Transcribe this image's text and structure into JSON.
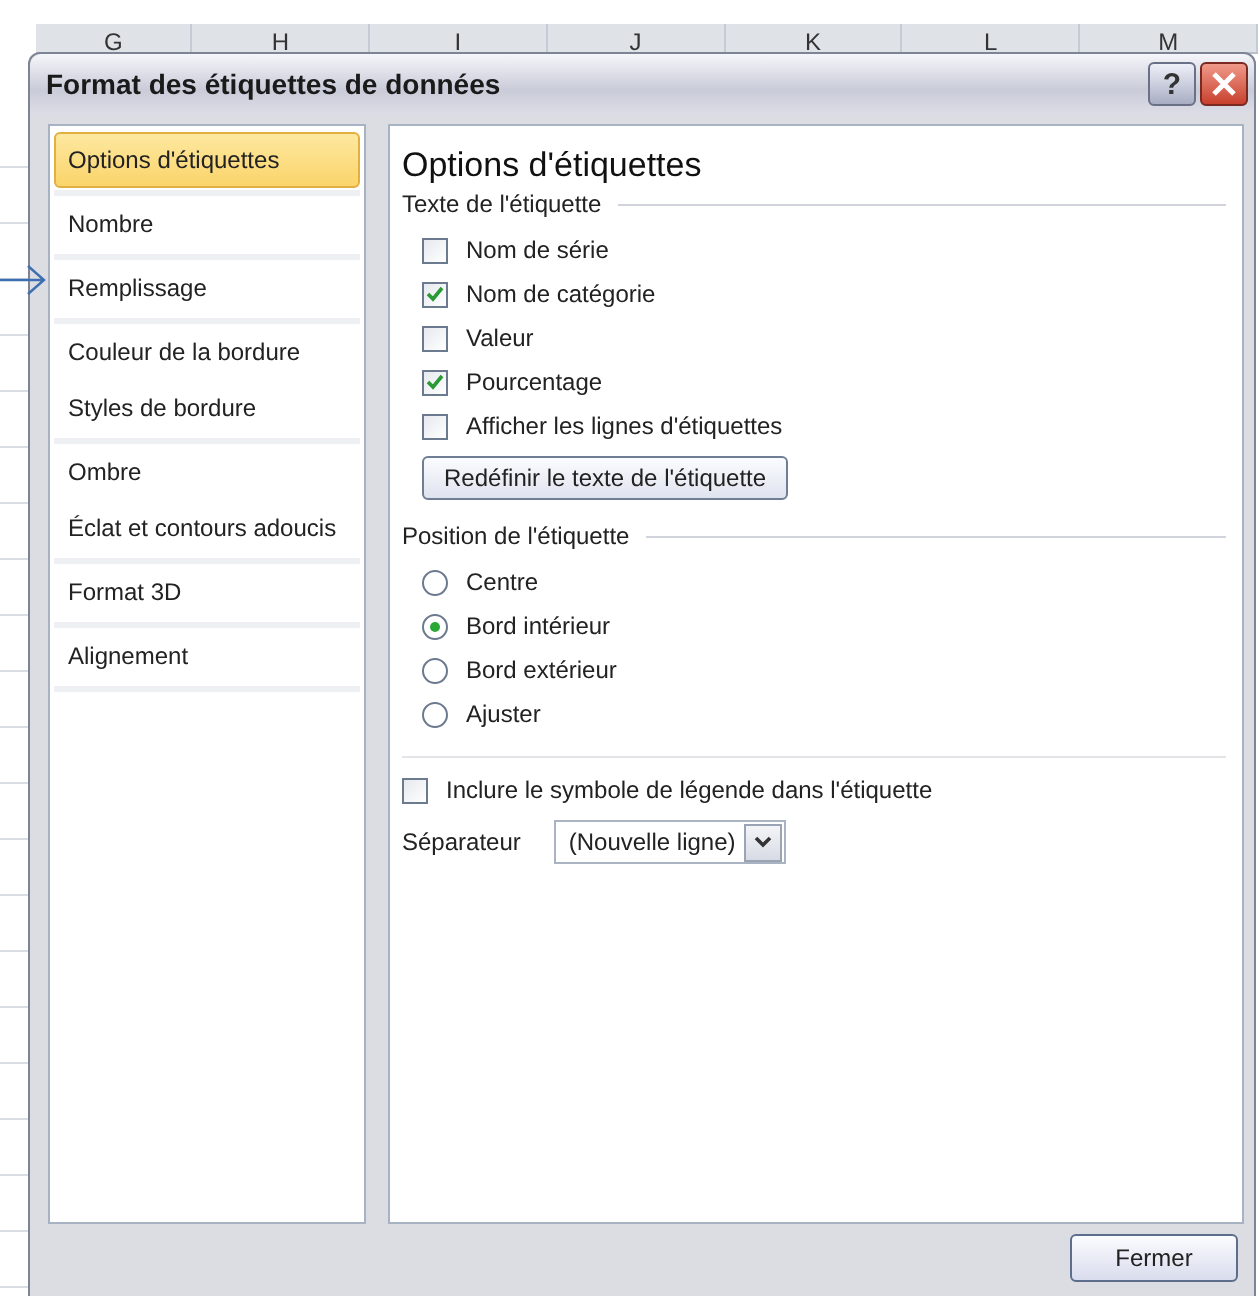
{
  "sheet": {
    "columns": [
      "G",
      "H",
      "I",
      "J",
      "K",
      "L",
      "M"
    ]
  },
  "window": {
    "title": "Format des étiquettes de données",
    "help": "?"
  },
  "sidebar": {
    "groups": [
      {
        "items": [
          {
            "label": "Options d'étiquettes",
            "selected": true
          }
        ]
      },
      {
        "items": [
          {
            "label": "Nombre",
            "selected": false
          }
        ]
      },
      {
        "items": [
          {
            "label": "Remplissage",
            "selected": false
          }
        ]
      },
      {
        "items": [
          {
            "label": "Couleur de la bordure",
            "selected": false
          },
          {
            "label": "Styles de bordure",
            "selected": false
          }
        ]
      },
      {
        "items": [
          {
            "label": "Ombre",
            "selected": false
          },
          {
            "label": "Éclat et contours adoucis",
            "selected": false
          }
        ]
      },
      {
        "items": [
          {
            "label": "Format 3D",
            "selected": false
          }
        ]
      },
      {
        "items": [
          {
            "label": "Alignement",
            "selected": false
          }
        ]
      }
    ]
  },
  "panel": {
    "title": "Options d'étiquettes",
    "label_text": {
      "heading": "Texte de l'étiquette",
      "options": [
        {
          "label": "Nom de série",
          "checked": false
        },
        {
          "label": "Nom de catégorie",
          "checked": true
        },
        {
          "label": "Valeur",
          "checked": false
        },
        {
          "label": "Pourcentage",
          "checked": true
        },
        {
          "label": "Afficher les lignes d'étiquettes",
          "checked": false
        }
      ],
      "reset_button": "Redéfinir le texte de l'étiquette"
    },
    "label_position": {
      "heading": "Position de l'étiquette",
      "options": [
        {
          "label": "Centre",
          "selected": false
        },
        {
          "label": "Bord intérieur",
          "selected": true
        },
        {
          "label": "Bord extérieur",
          "selected": false
        },
        {
          "label": "Ajuster",
          "selected": false
        }
      ]
    },
    "legend_key": {
      "label": "Inclure le symbole de légende dans l'étiquette",
      "checked": false
    },
    "separator": {
      "label": "Séparateur",
      "value": "(Nouvelle ligne)"
    }
  },
  "buttons": [
    "Fermer"
  ]
}
